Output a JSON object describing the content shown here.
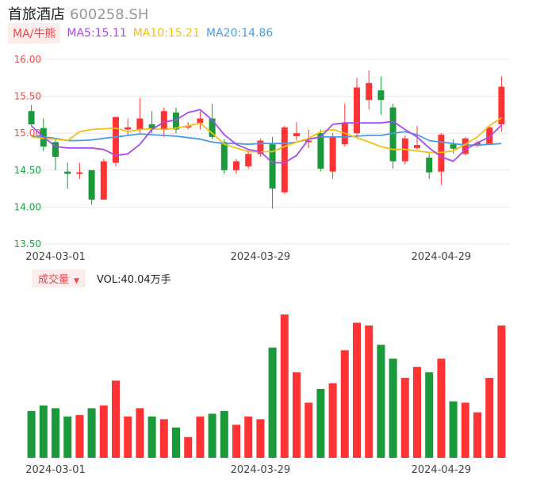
{
  "header": {
    "name": "首旅酒店",
    "code": "600258.SH"
  },
  "ma_legend": {
    "tag": "MA/牛熊",
    "ma5": "MA5:15.11",
    "ma10": "MA10:15.21",
    "ma20": "MA20:14.86"
  },
  "volume_legend": {
    "tag": "成交量",
    "value": "VOL:40.04万手"
  },
  "colors": {
    "up": "#ff3333",
    "down": "#1a9a3a",
    "ma5": "#a64bf0",
    "ma10": "#f3c012",
    "ma20": "#4a9be5",
    "grid": "#e8e8e8"
  },
  "chart_data": [
    {
      "type": "candlestick",
      "title": "",
      "y_ticks": [
        "16.00",
        "15.50",
        "15.00",
        "14.50",
        "14.00",
        "13.50"
      ],
      "ylim": [
        13.5,
        16.0
      ],
      "x_tick_labels": [
        "2024-03-01",
        "2024-03-29",
        "2024-04-29"
      ],
      "x_tick_index": [
        2,
        19,
        34
      ],
      "candles": [
        {
          "o": 15.3,
          "h": 15.38,
          "l": 15.1,
          "c": 15.12
        },
        {
          "o": 15.07,
          "h": 15.2,
          "l": 14.76,
          "c": 14.82
        },
        {
          "o": 14.88,
          "h": 14.92,
          "l": 14.5,
          "c": 14.68
        },
        {
          "o": 14.48,
          "h": 14.6,
          "l": 14.25,
          "c": 14.45
        },
        {
          "o": 14.46,
          "h": 14.6,
          "l": 14.38,
          "c": 14.47
        },
        {
          "o": 14.5,
          "h": 14.5,
          "l": 14.03,
          "c": 14.1
        },
        {
          "o": 14.1,
          "h": 14.65,
          "l": 14.1,
          "c": 14.62
        },
        {
          "o": 14.6,
          "h": 15.22,
          "l": 14.55,
          "c": 15.22
        },
        {
          "o": 15.05,
          "h": 15.2,
          "l": 14.98,
          "c": 15.08
        },
        {
          "o": 15.05,
          "h": 15.48,
          "l": 15.0,
          "c": 15.2
        },
        {
          "o": 15.12,
          "h": 15.3,
          "l": 15.0,
          "c": 15.05
        },
        {
          "o": 15.05,
          "h": 15.35,
          "l": 14.95,
          "c": 15.3
        },
        {
          "o": 15.28,
          "h": 15.35,
          "l": 15.0,
          "c": 15.05
        },
        {
          "o": 15.1,
          "h": 15.15,
          "l": 15.05,
          "c": 15.1
        },
        {
          "o": 15.14,
          "h": 15.3,
          "l": 15.05,
          "c": 15.2
        },
        {
          "o": 15.2,
          "h": 15.4,
          "l": 14.92,
          "c": 14.95
        },
        {
          "o": 14.88,
          "h": 14.92,
          "l": 14.45,
          "c": 14.5
        },
        {
          "o": 14.5,
          "h": 14.65,
          "l": 14.45,
          "c": 14.62
        },
        {
          "o": 14.55,
          "h": 14.78,
          "l": 14.52,
          "c": 14.72
        },
        {
          "o": 14.72,
          "h": 14.93,
          "l": 14.68,
          "c": 14.9
        },
        {
          "o": 14.85,
          "h": 14.95,
          "l": 13.98,
          "c": 14.25
        },
        {
          "o": 14.2,
          "h": 15.1,
          "l": 14.18,
          "c": 15.08
        },
        {
          "o": 14.96,
          "h": 15.15,
          "l": 14.9,
          "c": 15.0
        },
        {
          "o": 14.88,
          "h": 15.05,
          "l": 14.8,
          "c": 14.9
        },
        {
          "o": 15.0,
          "h": 15.05,
          "l": 14.48,
          "c": 14.52
        },
        {
          "o": 14.48,
          "h": 15.0,
          "l": 14.38,
          "c": 14.95
        },
        {
          "o": 14.85,
          "h": 15.4,
          "l": 14.82,
          "c": 15.14
        },
        {
          "o": 15.0,
          "h": 15.75,
          "l": 14.95,
          "c": 15.62
        },
        {
          "o": 15.45,
          "h": 15.85,
          "l": 15.32,
          "c": 15.68
        },
        {
          "o": 15.58,
          "h": 15.77,
          "l": 15.25,
          "c": 15.45
        },
        {
          "o": 15.35,
          "h": 15.4,
          "l": 14.52,
          "c": 14.62
        },
        {
          "o": 14.62,
          "h": 14.97,
          "l": 14.58,
          "c": 14.93
        },
        {
          "o": 14.8,
          "h": 15.1,
          "l": 14.78,
          "c": 14.84
        },
        {
          "o": 14.67,
          "h": 14.73,
          "l": 14.38,
          "c": 14.47
        },
        {
          "o": 14.48,
          "h": 15.0,
          "l": 14.3,
          "c": 14.98
        },
        {
          "o": 14.85,
          "h": 14.92,
          "l": 14.72,
          "c": 14.79
        },
        {
          "o": 14.72,
          "h": 14.95,
          "l": 14.7,
          "c": 14.93
        },
        {
          "o": 14.83,
          "h": 14.9,
          "l": 14.81,
          "c": 14.87
        },
        {
          "o": 14.85,
          "h": 15.1,
          "l": 14.85,
          "c": 15.08
        },
        {
          "o": 15.12,
          "h": 15.77,
          "l": 15.02,
          "c": 15.63
        }
      ],
      "ma5": [
        15.1,
        14.95,
        14.82,
        14.8,
        14.8,
        14.8,
        14.78,
        14.7,
        14.72,
        14.85,
        15.05,
        15.15,
        15.18,
        15.28,
        15.32,
        15.18,
        14.98,
        14.85,
        14.78,
        14.75,
        14.6,
        14.6,
        14.7,
        14.92,
        14.95,
        15.12,
        15.14,
        15.14,
        15.14,
        15.14,
        15.16,
        15.05,
        14.95,
        14.8,
        14.68,
        14.62,
        14.78,
        14.87,
        14.95,
        15.11
      ],
      "ma10": [
        14.95,
        14.93,
        14.92,
        14.9,
        15.02,
        15.05,
        15.06,
        15.07,
        15.02,
        15.05,
        15.06,
        15.05,
        15.07,
        15.1,
        15.14,
        15.0,
        14.85,
        14.8,
        14.75,
        14.75,
        14.75,
        14.82,
        14.88,
        14.93,
        15.02,
        15.05,
        15.0,
        14.94,
        14.88,
        14.82,
        14.78,
        14.78,
        14.76,
        14.74,
        14.74,
        14.76,
        14.85,
        14.95,
        15.1,
        15.21
      ],
      "ma20": [
        14.96,
        14.95,
        14.93,
        14.9,
        14.9,
        14.91,
        14.93,
        14.95,
        14.97,
        14.99,
        14.98,
        14.97,
        14.96,
        14.94,
        14.92,
        14.88,
        14.86,
        14.86,
        14.85,
        14.86,
        14.86,
        14.86,
        14.88,
        14.92,
        14.95,
        14.95,
        14.95,
        14.96,
        14.97,
        14.97,
        15.0,
        15.02,
        14.98,
        14.9,
        14.88,
        14.86,
        14.84,
        14.84,
        14.85,
        14.86
      ]
    },
    {
      "type": "bar",
      "title": "",
      "x_tick_labels": [
        "2024-03-01",
        "2024-03-29",
        "2024-04-29"
      ],
      "values": [
        17,
        19,
        18,
        15,
        15.5,
        18,
        19,
        28,
        15,
        18,
        15,
        14,
        11,
        7.5,
        15,
        16,
        17,
        12,
        15,
        14,
        40,
        52,
        31,
        20,
        25,
        27,
        39,
        49,
        48,
        41,
        36,
        29,
        33,
        31,
        36,
        20.5,
        20,
        16.5,
        29,
        48
      ]
    }
  ]
}
